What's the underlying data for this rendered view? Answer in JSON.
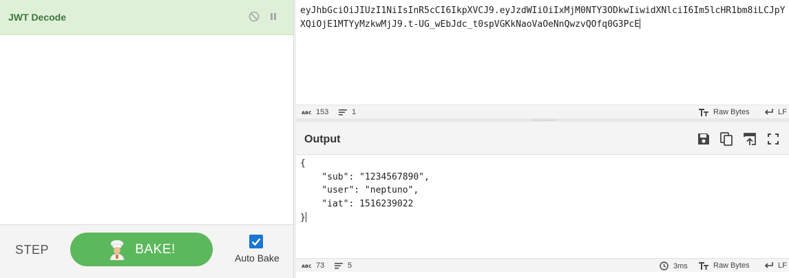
{
  "recipe": {
    "operation": {
      "title": "JWT Decode",
      "disable_icon": "disable-icon",
      "pause_icon": "pause-icon"
    },
    "controls": {
      "step_label": "STEP",
      "bake_label": "BAKE!",
      "bake_icon": "chef-icon",
      "auto_bake_label": "Auto Bake",
      "auto_bake_checked": true
    }
  },
  "input": {
    "text": "eyJhbGciOiJIUzI1NiIsInR5cCI6IkpXVCJ9.eyJzdWIiOiIxMjM0NTY3ODkwIiwidXNlciI6Im5lcHR1bm8iLCJpYXQiOjE1MTYyMzkwMjJ9.t-UG_wEbJdc_t0spVGKkNaoVaOeNnQwzvQOfq0G3PcE",
    "status": {
      "chars": "153",
      "lines": "1",
      "encoding": "Raw Bytes",
      "eol": "LF"
    }
  },
  "output": {
    "title": "Output",
    "toolbar_icons": [
      "save-icon",
      "copy-icon",
      "replace-input-icon",
      "maximise-icon"
    ],
    "text": "{\n    \"sub\": \"1234567890\",\n    \"user\": \"neptuno\",\n    \"iat\": 1516239022\n}",
    "status": {
      "chars": "73",
      "lines": "5",
      "time": "3ms",
      "encoding": "Raw Bytes",
      "eol": "LF"
    }
  },
  "colors": {
    "operation_bg": "#dff0d8",
    "operation_text": "#3c763d",
    "bake_green": "#5cb85c",
    "checkbox_blue": "#1976d2"
  }
}
